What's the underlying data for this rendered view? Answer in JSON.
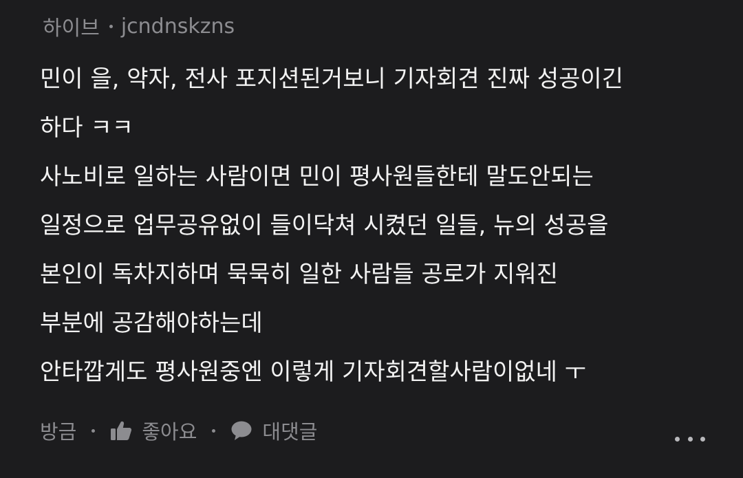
{
  "comment": {
    "community": "하이브",
    "author": "jcndnskzns",
    "lines": [
      "민이 을, 약자, 전사 포지션된거보니 기자회견 진짜 성공이긴",
      "하다 ㅋㅋ",
      "사노비로 일하는 사람이면 민이 평사원들한테 말도안되는",
      "일정으로 업무공유없이 들이닥쳐 시켰던 일들, 뉴의 성공을",
      "본인이 독차지하며 묵묵히 일한 사람들 공로가 지워진",
      "부분에 공감해야하는데",
      "안타깝게도 평사원중엔 이렇게 기자회견할사람이없네 ㅜ"
    ],
    "timestamp": "방금",
    "like_label": "좋아요",
    "reply_label": "대댓글",
    "icons": {
      "like": "thumbs-up-icon",
      "reply": "speech-bubble-icon",
      "more": "more-dots-icon"
    }
  },
  "colors": {
    "background": "#1c1c1e",
    "text": "#f2f2f2",
    "muted": "#8c8c90"
  }
}
